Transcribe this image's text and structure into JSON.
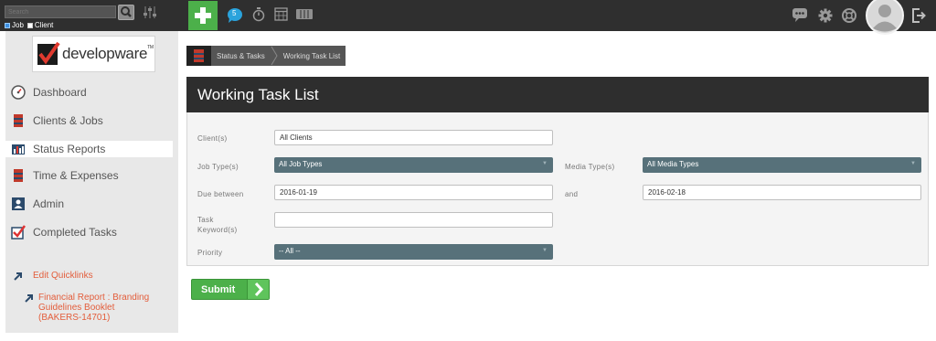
{
  "topbar": {
    "search_placeholder": "Search",
    "scope": [
      {
        "label": "Job",
        "checked": true
      },
      {
        "label": "Client",
        "checked": false
      }
    ],
    "notification_count": "5",
    "icons": [
      "add-icon",
      "chat-icon",
      "stopwatch-icon",
      "calendar-icon",
      "cards-icon",
      "message-icon",
      "gear-icon",
      "help-icon",
      "avatar",
      "logout-icon"
    ]
  },
  "sidebar": {
    "logo_text": "developware",
    "logo_tm": "TM",
    "items": [
      {
        "label": "Dashboard",
        "icon": "dashboard-icon"
      },
      {
        "label": "Clients & Jobs",
        "icon": "cabinet-icon"
      },
      {
        "label": "Status Reports",
        "icon": "bar-chart-icon",
        "active": true
      },
      {
        "label": "Time & Expenses",
        "icon": "cabinet-icon"
      },
      {
        "label": "Admin",
        "icon": "admin-icon"
      },
      {
        "label": "Completed Tasks",
        "icon": "checkbox-icon"
      }
    ],
    "quicklinks": {
      "edit_label": "Edit Quicklinks",
      "links": [
        "Financial Report : Branding Guidelines Booklet (BAKERS-14701)"
      ]
    }
  },
  "breadcrumb": [
    "Status & Tasks",
    "Working Task List"
  ],
  "panel": {
    "title": "Working Task List",
    "fields": {
      "client_label": "Client(s)",
      "client_value": "All Clients",
      "job_type_label": "Job Type(s)",
      "job_type_value": "All Job Types",
      "media_type_label": "Media Type(s)",
      "media_type_value": "All Media Types",
      "due_label": "Due between",
      "due_from": "2016-01-19",
      "due_and_label": "and",
      "due_to": "2016-02-18",
      "keyword_label_1": "Task",
      "keyword_label_2": "Keyword(s)",
      "keyword_value": "",
      "priority_label": "Priority",
      "priority_value": "-- All --"
    }
  },
  "submit_label": "Submit",
  "colors": {
    "topbar": "#2f2f2f",
    "accent_green": "#4cb04a",
    "select_bg": "#57717a",
    "link": "#e35d3b"
  }
}
